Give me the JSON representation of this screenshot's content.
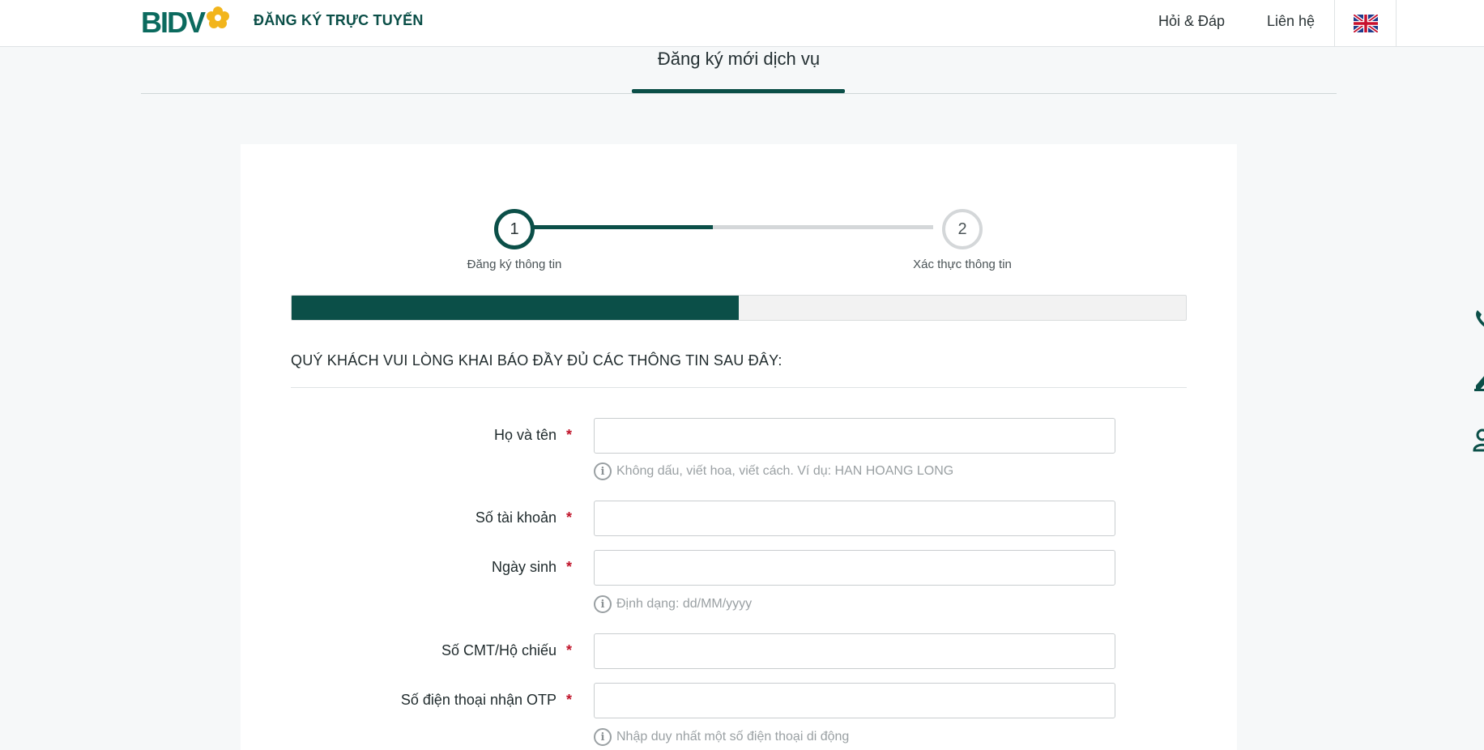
{
  "header": {
    "logo_text": "BIDV",
    "site_title": "ĐĂNG KÝ TRỰC TUYẾN",
    "nav": {
      "faq": "Hỏi & Đáp",
      "contact": "Liên hệ"
    },
    "language_icon": "uk-flag-icon"
  },
  "page_tab": {
    "label": "Đăng ký mới dịch vụ"
  },
  "stepper": {
    "steps": [
      {
        "number": "1",
        "label": "Đăng ký thông tin",
        "state": "active"
      },
      {
        "number": "2",
        "label": "Xác thực thông tin",
        "state": "pending"
      }
    ],
    "progress_fraction": 0.5
  },
  "form": {
    "heading": "QUÝ KHÁCH VUI LÒNG KHAI BÁO ĐẦY ĐỦ CÁC THÔNG TIN SAU ĐÂY:",
    "required_mark": "*",
    "fields": [
      {
        "label": "Họ và tên",
        "value": "",
        "hint": "Không dấu, viết hoa, viết cách. Ví dụ: HAN HOANG LONG"
      },
      {
        "label": "Số tài khoản",
        "value": ""
      },
      {
        "label": "Ngày sinh",
        "value": "",
        "hint": "Định dạng: dd/MM/yyyy"
      },
      {
        "label": "Số CMT/Hộ chiếu",
        "value": ""
      },
      {
        "label": "Số điện thoại nhận OTP",
        "value": "",
        "hint": "Nhập duy nhất một số điện thoại di động"
      }
    ],
    "hint_icon": "info-icon"
  },
  "colors": {
    "brand": "#0b4f48",
    "logo_green": "#0b6a5e",
    "logo_flower": "#f2b51c",
    "required": "#c0142a"
  },
  "side_icons": [
    "phone-icon",
    "edit-icon",
    "user-icon"
  ]
}
